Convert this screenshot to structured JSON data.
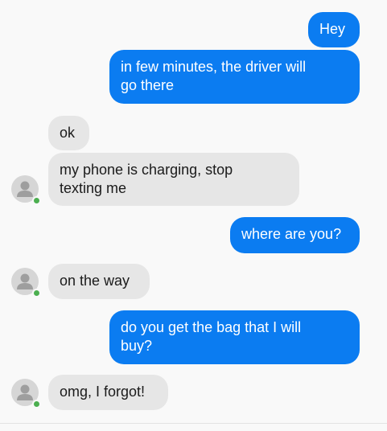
{
  "colors": {
    "outgoing_bubble": "#0b7cf1",
    "incoming_bubble": "#e6e6e6",
    "online_indicator": "#4caf50",
    "background": "#f9f9f9"
  },
  "messages": [
    {
      "sender": "me",
      "text": "Hey"
    },
    {
      "sender": "me",
      "text": "in few minutes, the driver will\ngo there"
    },
    {
      "sender": "contact",
      "text": "ok"
    },
    {
      "sender": "contact",
      "text": "my phone is charging, stop\ntexting me"
    },
    {
      "sender": "me",
      "text": "where are you?"
    },
    {
      "sender": "contact",
      "text": "on the way"
    },
    {
      "sender": "me",
      "text": "do you get the bag that I will\nbuy?"
    },
    {
      "sender": "contact",
      "text": "omg, I forgot!"
    }
  ]
}
